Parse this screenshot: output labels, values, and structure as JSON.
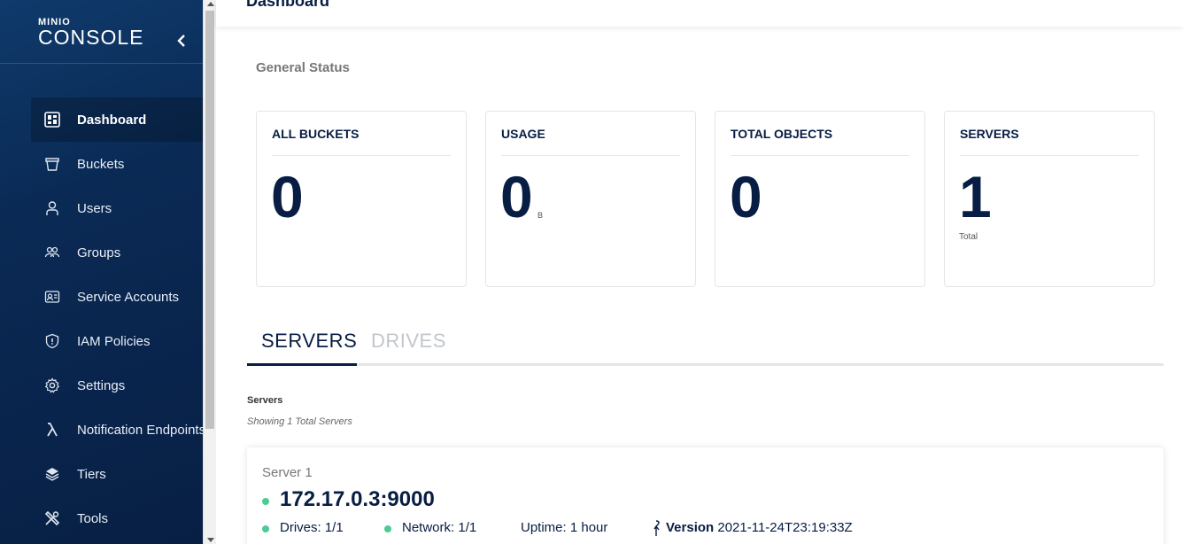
{
  "brand": {
    "small": "MINIO",
    "main": "CONSOLE"
  },
  "sidebar": {
    "items": [
      {
        "label": "Dashboard",
        "icon": "dashboard-icon",
        "active": true
      },
      {
        "label": "Buckets",
        "icon": "bucket-icon"
      },
      {
        "label": "Users",
        "icon": "user-icon"
      },
      {
        "label": "Groups",
        "icon": "groups-icon"
      },
      {
        "label": "Service Accounts",
        "icon": "service-accounts-icon"
      },
      {
        "label": "IAM Policies",
        "icon": "shield-icon"
      },
      {
        "label": "Settings",
        "icon": "gear-icon"
      },
      {
        "label": "Notification Endpoints",
        "icon": "lambda-icon"
      },
      {
        "label": "Tiers",
        "icon": "layers-icon"
      },
      {
        "label": "Tools",
        "icon": "tools-icon"
      }
    ]
  },
  "header": {
    "title": "Dashboard"
  },
  "general_status": {
    "title": "General Status",
    "cards": [
      {
        "label": "ALL BUCKETS",
        "value": "0"
      },
      {
        "label": "USAGE",
        "value": "0",
        "unit": "B"
      },
      {
        "label": "TOTAL OBJECTS",
        "value": "0"
      },
      {
        "label": "SERVERS",
        "value": "1",
        "sub": "Total"
      }
    ]
  },
  "tabs": [
    {
      "label": "SERVERS",
      "active": true
    },
    {
      "label": "DRIVES"
    }
  ],
  "servers": {
    "heading": "Servers",
    "subheading": "Showing 1 Total Servers",
    "list": [
      {
        "name": "Server 1",
        "endpoint": "172.17.0.3:9000",
        "drives": "Drives: 1/1",
        "network": "Network: 1/1",
        "uptime": "Uptime: 1 hour",
        "version_label": "Version",
        "version": "2021-11-24T23:19:33Z"
      }
    ]
  },
  "colors": {
    "sidebar_bg": "#0a2a55",
    "primary": "#071D43",
    "status_ok": "#4CCB92"
  }
}
